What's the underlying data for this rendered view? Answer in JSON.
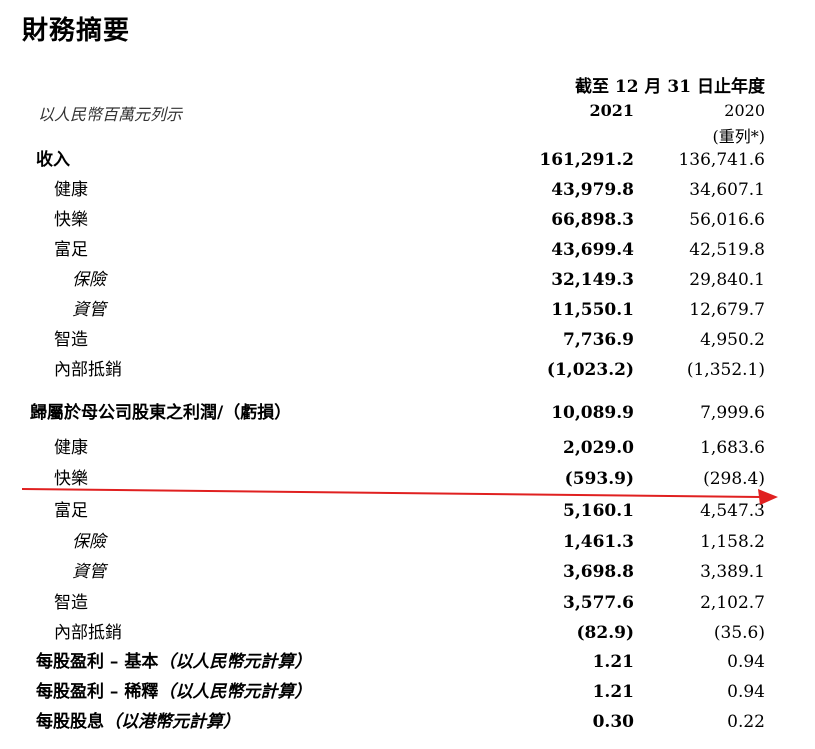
{
  "title": "財務摘要",
  "header": {
    "period": "截至 12 月 31 日止年度",
    "unit": "以人民幣百萬元列示",
    "col_2021": "2021",
    "col_2020": "2020",
    "col_2020_note": "(重列*)"
  },
  "revenue": {
    "total": {
      "label": "收入",
      "v2021": "161,291.2",
      "v2020": "136,741.6"
    },
    "items": [
      {
        "label": "健康",
        "v2021": "43,979.8",
        "v2020": "34,607.1"
      },
      {
        "label": "快樂",
        "v2021": "66,898.3",
        "v2020": "56,016.6"
      },
      {
        "label": "富足",
        "v2021": "43,699.4",
        "v2020": "42,519.8"
      },
      {
        "label": "保險",
        "v2021": "32,149.3",
        "v2020": "29,840.1"
      },
      {
        "label": "資管",
        "v2021": "11,550.1",
        "v2020": "12,679.7"
      },
      {
        "label": "智造",
        "v2021": "7,736.9",
        "v2020": "4,950.2"
      },
      {
        "label": "內部抵銷",
        "v2021": "(1,023.2)",
        "v2020": "(1,352.1)"
      }
    ]
  },
  "profit": {
    "total": {
      "label": "歸屬於母公司股東之利潤/（虧損）",
      "v2021": "10,089.9",
      "v2020": "7,999.6"
    },
    "items": [
      {
        "label": "健康",
        "v2021": "2,029.0",
        "v2020": "1,683.6"
      },
      {
        "label": "快樂",
        "v2021": "(593.9)",
        "v2020": "(298.4)"
      },
      {
        "label": "富足",
        "v2021": "5,160.1",
        "v2020": "4,547.3"
      },
      {
        "label": "保險",
        "v2021": "1,461.3",
        "v2020": "1,158.2"
      },
      {
        "label": "資管",
        "v2021": "3,698.8",
        "v2020": "3,389.1"
      },
      {
        "label": "智造",
        "v2021": "3,577.6",
        "v2020": "2,102.7"
      },
      {
        "label": "內部抵銷",
        "v2021": "(82.9)",
        "v2020": "(35.6)"
      }
    ]
  },
  "per_share": [
    {
      "label": "每股盈利 – 基本",
      "note": "（以人民幣元計算）",
      "v2021": "1.21",
      "v2020": "0.94"
    },
    {
      "label": "每股盈利 – 稀釋",
      "note": "（以人民幣元計算）",
      "v2021": "1.21",
      "v2020": "0.94"
    },
    {
      "label": "每股股息",
      "note": "（以港幣元計算）",
      "v2021": "0.30",
      "v2020": "0.22"
    }
  ],
  "annotation": {
    "color": "#e02020"
  }
}
